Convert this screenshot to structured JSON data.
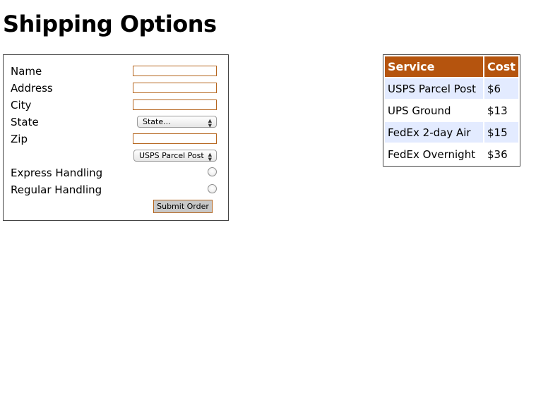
{
  "page": {
    "title": "Shipping Options"
  },
  "form": {
    "fields": [
      {
        "label": "Name",
        "value": "",
        "placeholder": ""
      },
      {
        "label": "Address",
        "value": "",
        "placeholder": ""
      },
      {
        "label": "City",
        "value": "",
        "placeholder": ""
      },
      {
        "label": "State",
        "selected": "State..."
      },
      {
        "label": "Zip",
        "value": "",
        "placeholder": ""
      }
    ],
    "service_select": {
      "selected": "USPS Parcel Post"
    },
    "handling": [
      {
        "label": "Express Handling",
        "checked": false
      },
      {
        "label": "Regular Handling",
        "checked": false
      }
    ],
    "submit_label": "Submit Order",
    "select_arrow_glyph": "▲▼",
    "accent_color": "#b5651d"
  },
  "rates": {
    "headers": [
      "Service",
      "Cost"
    ],
    "header_color": "#b5540e",
    "stripe_color": "#e3ebff",
    "rows": [
      {
        "service": "USPS Parcel Post",
        "cost": "$6"
      },
      {
        "service": "UPS Ground",
        "cost": "$13"
      },
      {
        "service": "FedEx 2-day Air",
        "cost": "$15"
      },
      {
        "service": "FedEx Overnight",
        "cost": "$36"
      }
    ]
  }
}
